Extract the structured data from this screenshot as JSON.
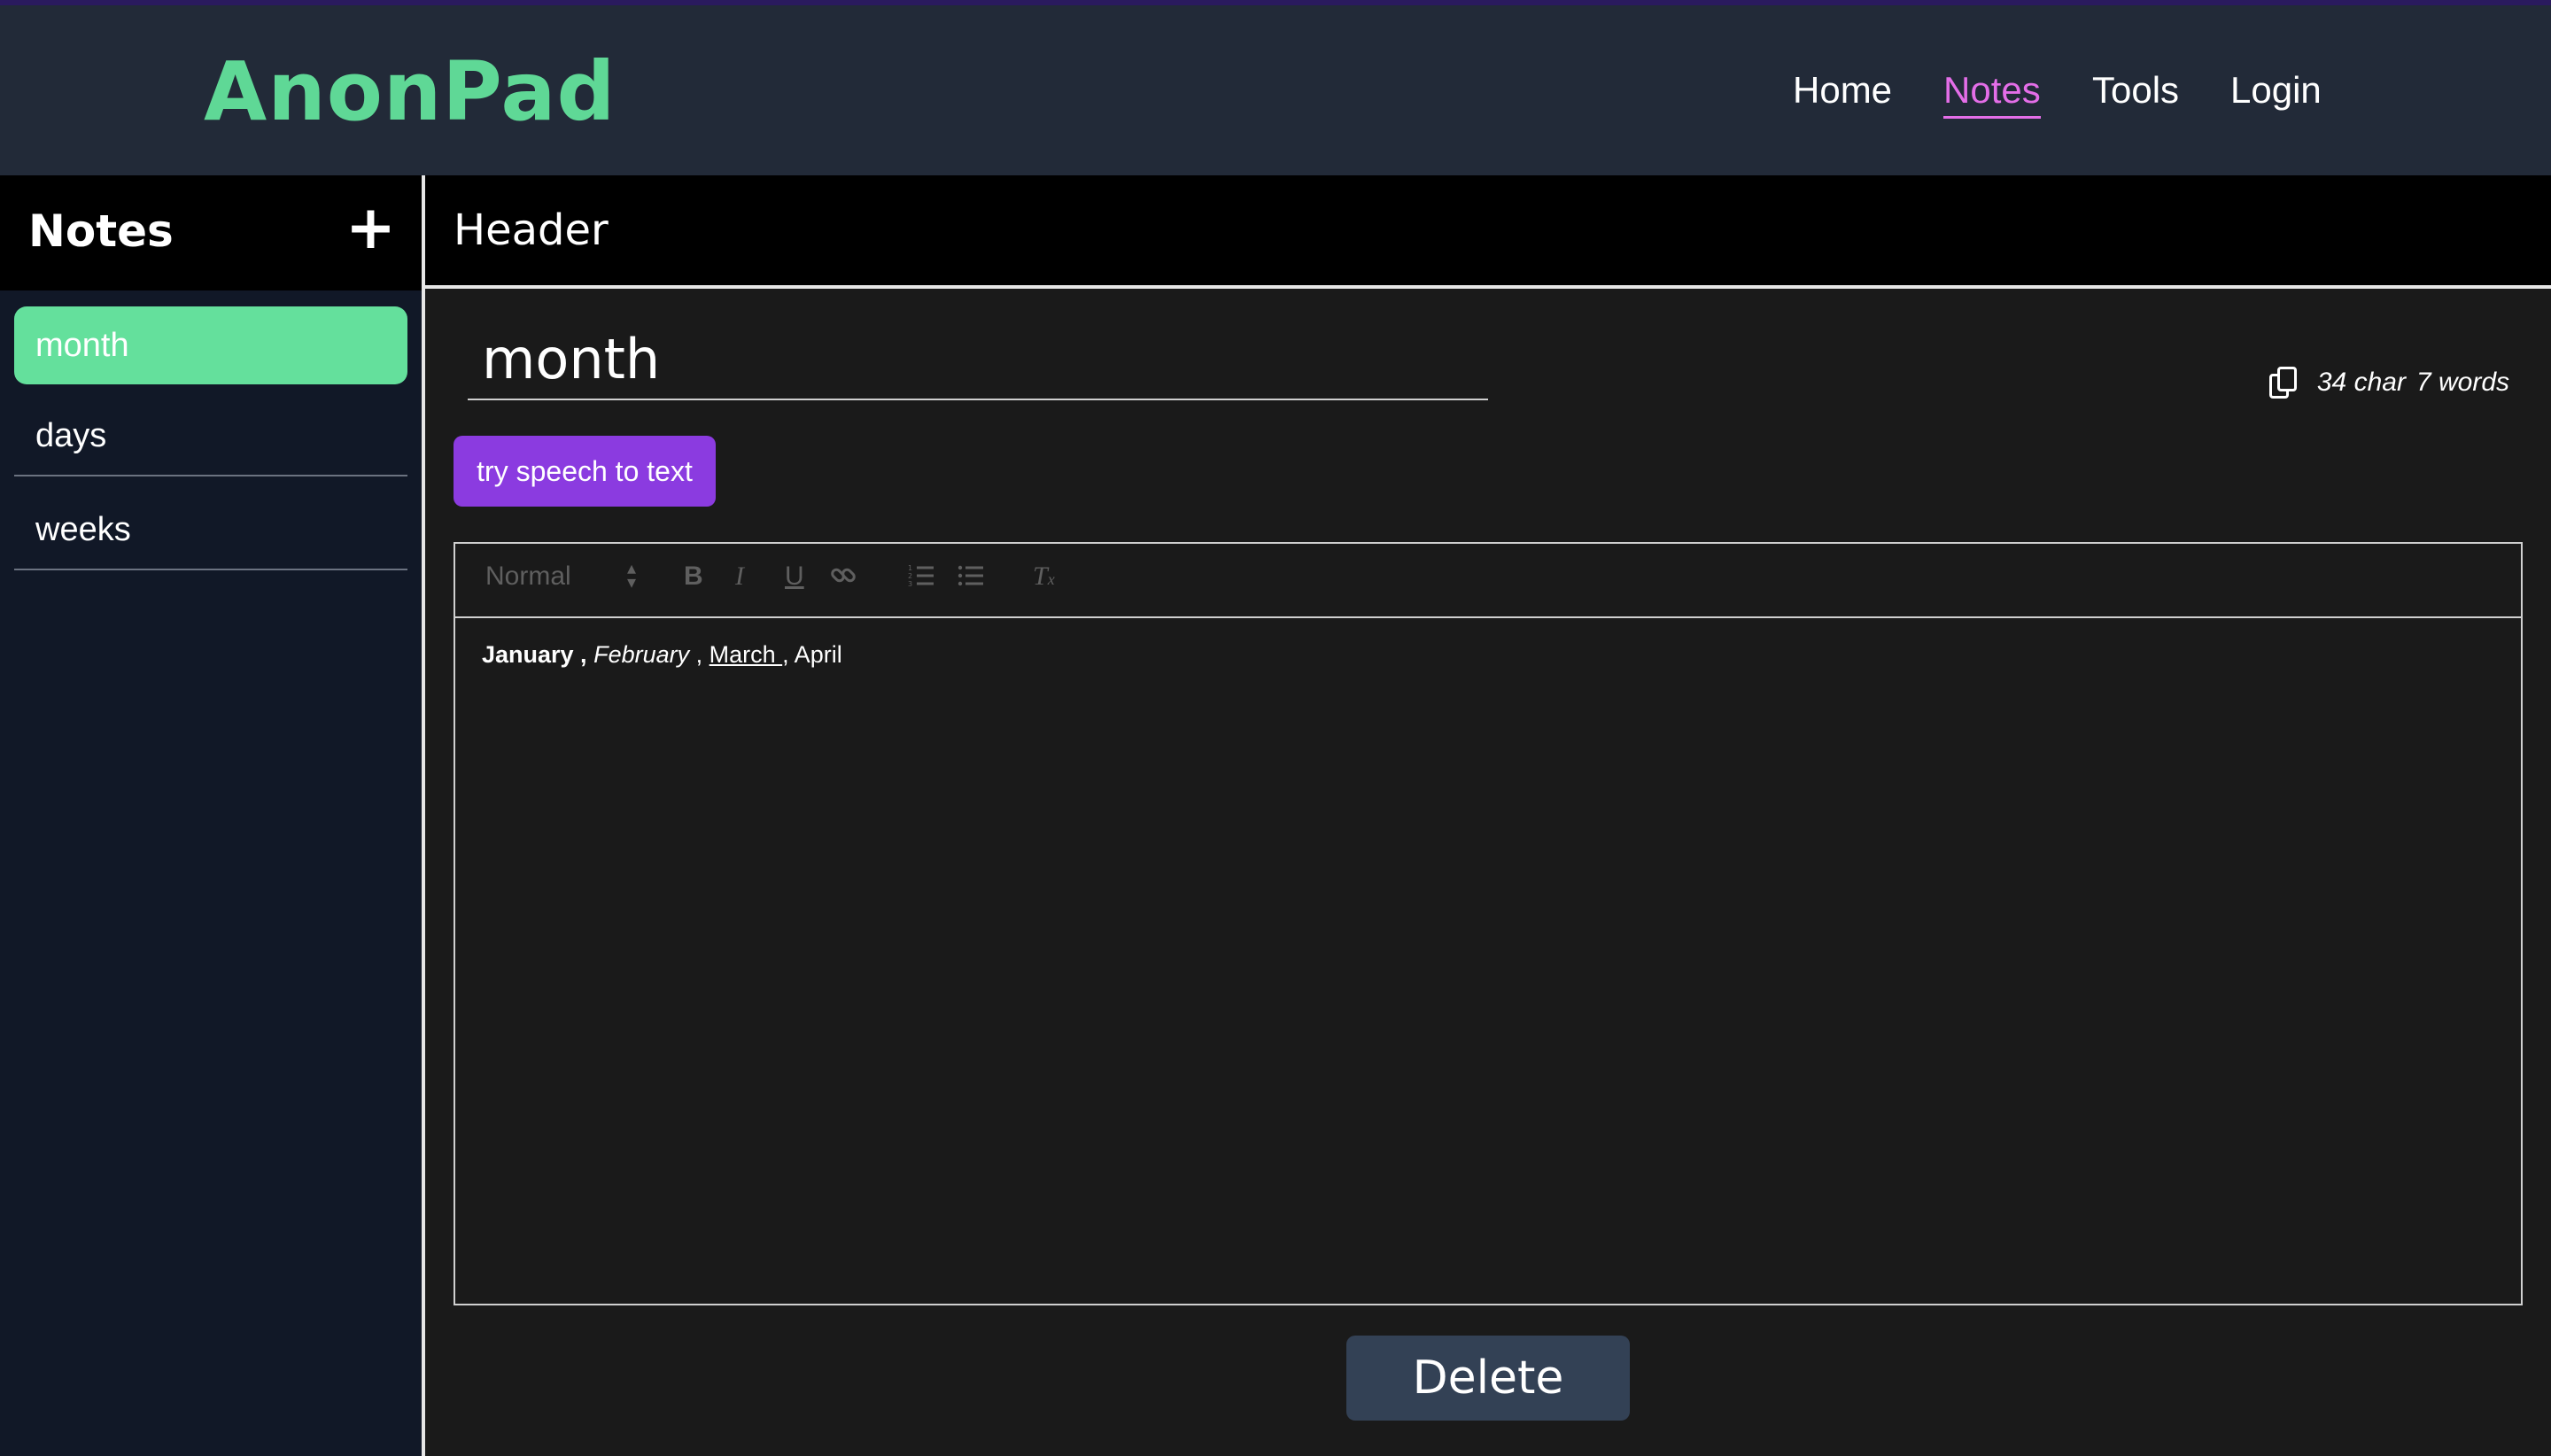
{
  "app": {
    "logo": "AnonPad"
  },
  "nav": {
    "home": "Home",
    "notes": "Notes",
    "tools": "Tools",
    "login": "Login"
  },
  "sidebar": {
    "title": "Notes",
    "add_label": "+",
    "items": [
      {
        "label": "month",
        "selected": true
      },
      {
        "label": "days",
        "selected": false
      },
      {
        "label": "weeks",
        "selected": false
      }
    ]
  },
  "main": {
    "header": "Header",
    "note_title": "month",
    "stats": {
      "chars": "34 char",
      "words": "7 words"
    },
    "speech_button": "try speech to text",
    "toolbar": {
      "format_select": "Normal",
      "bold": "B",
      "italic": "I",
      "underline": "U",
      "link": "🔗",
      "ordered_list": "☰",
      "bullet_list": "☰",
      "clean": "Tx"
    },
    "content": {
      "part1": "January ,",
      "part2": "February",
      "part3": " , ",
      "part4": "March ",
      "part5": ", April"
    },
    "delete_button": "Delete"
  },
  "colors": {
    "accent_green": "#64e09c",
    "accent_pink": "#e46ee8",
    "accent_purple": "#8b3be0",
    "navbar_bg": "#222a38",
    "sidebar_bg": "#111827"
  }
}
